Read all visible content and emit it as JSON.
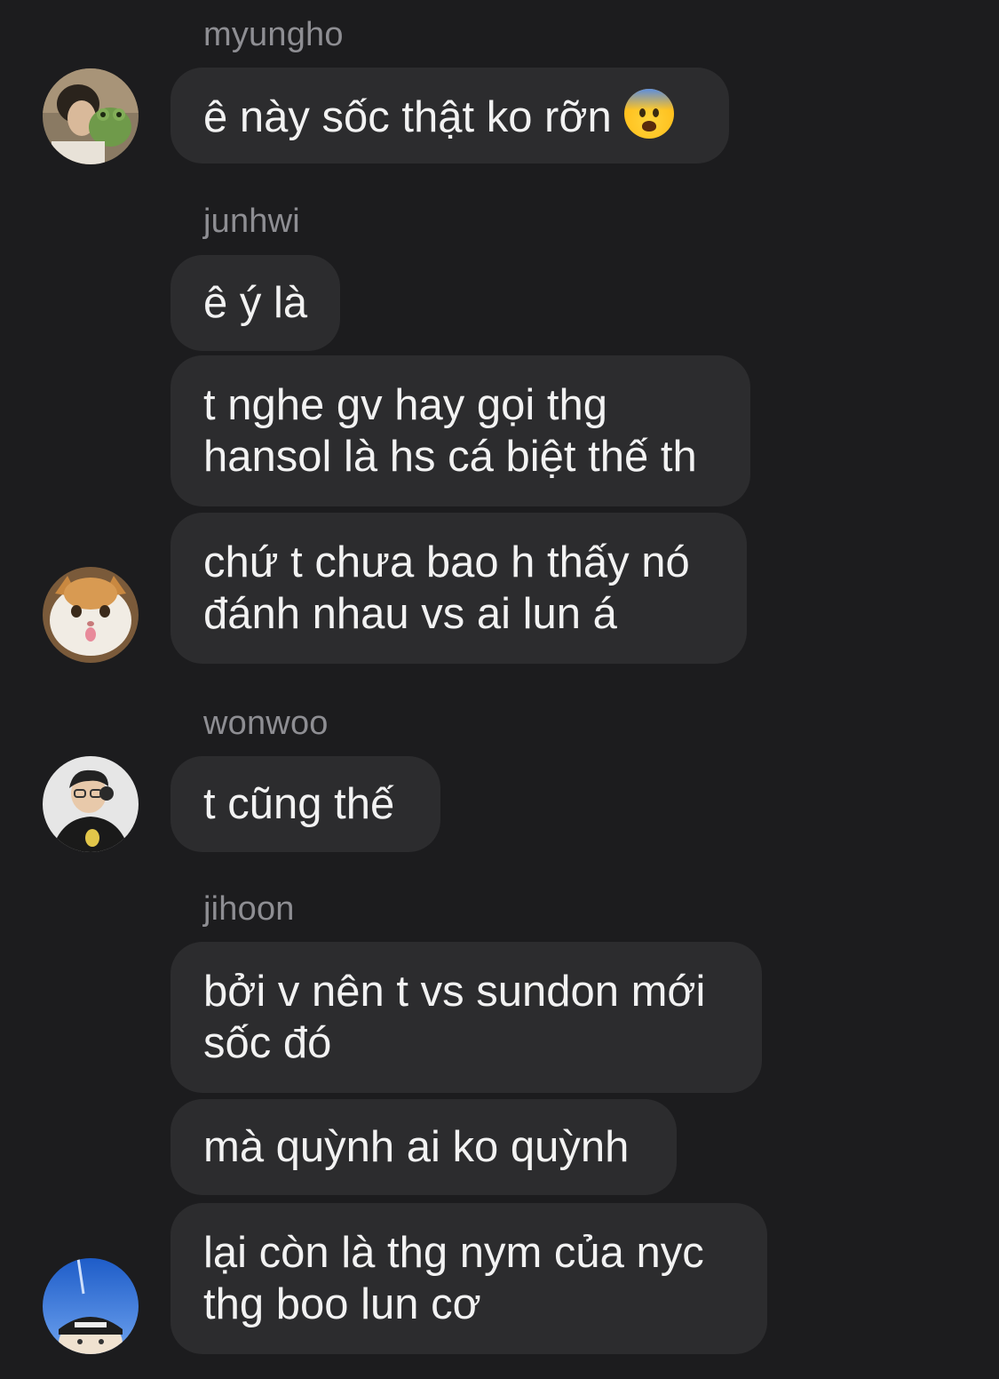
{
  "messages": [
    {
      "sender": "myungho",
      "lines": [
        "ê này sốc thật ko rỡn"
      ],
      "emoji": "anxious-face-emoji"
    },
    {
      "sender": "junhwi",
      "lines": [
        "ê ý là"
      ]
    },
    {
      "lines": [
        "t nghe gv hay gọi thg",
        "hansol là hs cá biệt thế th"
      ]
    },
    {
      "lines": [
        "chứ t chưa bao h thấy nó",
        "đánh nhau vs ai lun á"
      ]
    },
    {
      "sender": "wonwoo",
      "lines": [
        "t cũng thế"
      ]
    },
    {
      "sender": "jihoon",
      "lines": [
        "bởi v nên t vs sundon mới",
        "sốc đó"
      ]
    },
    {
      "lines": [
        "mà quỳnh ai ko quỳnh"
      ]
    },
    {
      "lines": [
        "lại còn là thg nym của nyc",
        "thg boo lun cơ"
      ]
    }
  ],
  "colors": {
    "background": "#1c1c1e",
    "bubble": "#2c2c2e",
    "text": "#f2f2f2",
    "sender": "#8e8e93"
  }
}
